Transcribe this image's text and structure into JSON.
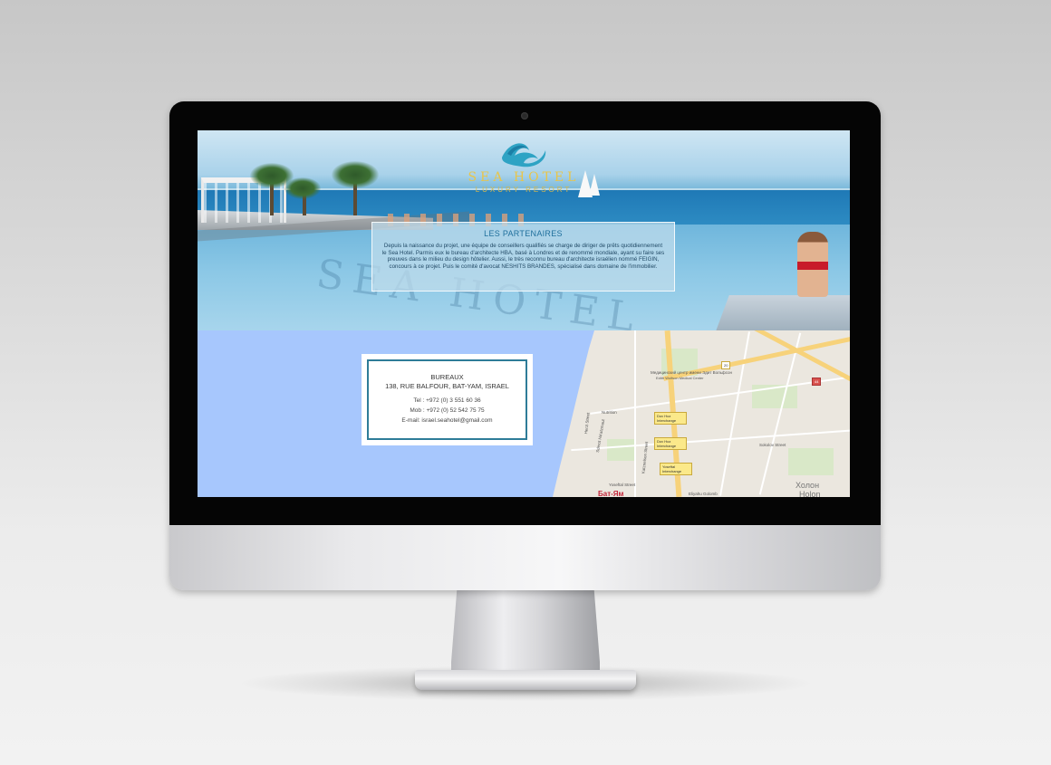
{
  "brand": {
    "name": "SEA HOTEL",
    "tagline": "LUXURY RESORT",
    "logo_icon": "wave-logo-icon",
    "colors": {
      "gold": "#e8c54a",
      "teal": "#2ea3c4"
    }
  },
  "partners": {
    "title": "LES PARTENAIRES",
    "text": "Depuis la naissance du projet, une équipe de conseillers qualifiés se charge de diriger de prêts quotidiennement le Sea Hotel. Parmis eux le bureau d'architecte HBA, basé à Londres et de renommé mondiale, ayant su faire ses preuves dans le milieu du design hôtelier. Aussi, le très reconnu bureau d'architecte israélien nommé FEIGIN, concours à ce projet. Puis le comité d'avocat NESHITS BRANDES, spécialisé dans domaine de l'immobilier."
  },
  "contact": {
    "title": "BUREAUX",
    "address": "138, RUE BALFOUR, BAT-YAM, ISRAEL",
    "tel": "Tel :   +972 (0) 3 551 60 36",
    "mob": "Mob : +972 (0) 52 542 75 75",
    "email": "E-mail: israel.seahotel@gmail.com",
    "border_color": "#2e7c98"
  },
  "map": {
    "labels": {
      "medical_center": "Медицинский центр имени Эдит Вольфсон",
      "medical_center_en": "Edith Wolfson Medical Center",
      "nutrition": "Nutrition",
      "herzl": "Herzl Street",
      "sderot": "Sderot Ha'atzmaut",
      "katznelson": "Katznelson Street",
      "sokolov": "Sokolov Street",
      "yoseftal_street": "Yoseftal Street",
      "elyahu": "Eliyahu Golomb",
      "dov_hoz_1": "Dov Hoz Interchange",
      "dov_hoz_2": "Dov Hoz Interchange",
      "yoseftal": "Yoseftal Interchange",
      "holon_ru": "Холон",
      "holon": "Holon",
      "bat_yam_ru": "Бат-Ям",
      "route_20": "20",
      "route_44": "44"
    }
  }
}
